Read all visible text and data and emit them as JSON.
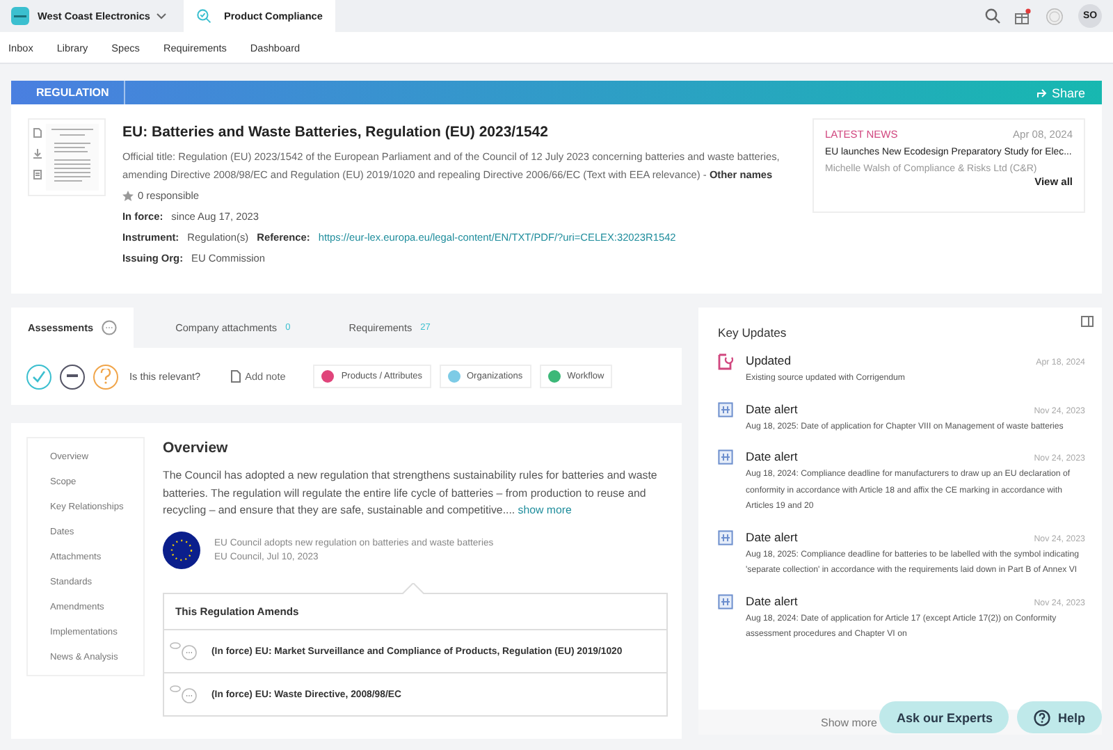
{
  "topbar": {
    "workspace": "West Coast Electronics",
    "app_tab": "Product Compliance",
    "avatar": "SO"
  },
  "nav": [
    "Inbox",
    "Library",
    "Specs",
    "Requirements",
    "Dashboard"
  ],
  "banner": {
    "label": "REGULATION",
    "share": "Share"
  },
  "regulation": {
    "title": "EU: Batteries and Waste Batteries, Regulation (EU) 2023/1542",
    "official_title": "Official title: Regulation (EU) 2023/1542 of the European Parliament and of the Council of 12 July 2023 concerning batteries and waste batteries, amending Directive 2008/98/EC and Regulation (EU) 2019/1020 and repealing Directive 2006/66/EC (Text with EEA relevance) -",
    "other_names": "Other names",
    "responsible": "0 responsible",
    "details": [
      {
        "fields": [
          {
            "label": "In force:",
            "value": "since Aug 17, 2023",
            "kind": "text"
          }
        ]
      },
      {
        "fields": [
          {
            "label": "Instrument:",
            "value": "Regulation(s)",
            "kind": "text"
          },
          {
            "label": "Reference:",
            "value": "https://eur-lex.europa.eu/legal-content/EN/TXT/PDF/?uri=CELEX:32023R1542",
            "kind": "link"
          }
        ]
      },
      {
        "fields": [
          {
            "label": "Issuing Org:",
            "value": "EU Commission",
            "kind": "text"
          }
        ]
      }
    ]
  },
  "latest_news": {
    "label": "LATEST NEWS",
    "date": "Apr 08, 2024",
    "headline": "EU launches New Ecodesign Preparatory Study for Elec...",
    "source": "Michelle Walsh of Compliance & Risks Ltd (C&R)",
    "view_all": "View all"
  },
  "tabs": [
    {
      "label": "Assessments",
      "selected": true
    },
    {
      "label": "Company attachments",
      "count": "0",
      "selected": false
    },
    {
      "label": "Requirements",
      "count": "27",
      "selected": false
    }
  ],
  "assessment": {
    "question": "Is this relevant?",
    "add_note": "Add note",
    "chips": [
      {
        "label": "Products / Attributes",
        "color": "#e0457b"
      },
      {
        "label": "Organizations",
        "color": "#7dcbe6"
      },
      {
        "label": "Workflow",
        "color": "#3cb878"
      }
    ]
  },
  "overview": {
    "side_nav": [
      "Overview",
      "Scope",
      "Key Relationships",
      "Dates",
      "Attachments",
      "Standards",
      "Amendments",
      "Implementations",
      "News & Analysis"
    ],
    "title": "Overview",
    "text": "The Council has adopted a new regulation that strengthens sustainability rules for batteries and waste batteries. The regulation will regulate the entire life cycle of batteries – from production to reuse and recycling – and ensure that they are safe, sustainable and competitive....",
    "show_more": "show more",
    "news": {
      "headline": "EU Council adopts new regulation on batteries and waste batteries",
      "source": "EU Council, Jul 10, 2023"
    },
    "amends": {
      "title": "This Regulation Amends",
      "items": [
        "(In force) EU: Market Surveillance and Compliance of Products, Regulation (EU) 2019/1020",
        "(In force) EU: Waste Directive, 2008/98/EC"
      ]
    }
  },
  "key_updates": {
    "title": "Key Updates",
    "items": [
      {
        "kind": "updated",
        "title": "Updated",
        "date": "Apr 18, 2024",
        "text": "Existing source updated with Corrigendum"
      },
      {
        "kind": "date_alert",
        "title": "Date alert",
        "date": "Nov 24, 2023",
        "text": "Aug 18, 2025: Date of application for Chapter VIII on Management of waste batteries"
      },
      {
        "kind": "date_alert",
        "title": "Date alert",
        "date": "Nov 24, 2023",
        "text": "Aug 18, 2024: Compliance deadline for manufacturers to draw up an EU declaration of conformity in accordance with Article 18 and affix the CE marking in accordance with Articles 19 and 20"
      },
      {
        "kind": "date_alert",
        "title": "Date alert",
        "date": "Nov 24, 2023",
        "text": "Aug 18, 2025: Compliance deadline for batteries to be labelled with the symbol indicating 'separate collection' in accordance with the requirements laid down in Part B of Annex VI"
      },
      {
        "kind": "date_alert",
        "title": "Date alert",
        "date": "Nov 24, 2023",
        "text": "Aug 18, 2024: Date of application for Article 17 (except Article 17(2)) on Conformity assessment procedures and Chapter VI on"
      }
    ],
    "show_more": "Show more"
  },
  "floating": [
    {
      "kind": "experts",
      "label": "Ask our Experts"
    },
    {
      "kind": "help",
      "label": "Help"
    }
  ]
}
